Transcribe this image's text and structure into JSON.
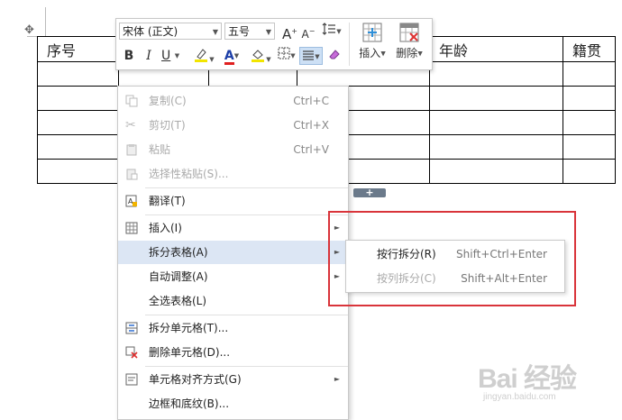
{
  "table": {
    "headers": [
      "序号",
      "",
      "",
      "",
      "年龄",
      "籍贯"
    ],
    "blank_rows": 5
  },
  "toolbar": {
    "font_name": "宋体 (正文)",
    "font_size": "五号",
    "grow_font_label": "A",
    "shrink_font_label": "A",
    "bold_label": "B",
    "italic_label": "I",
    "underline_label": "U",
    "font_color_label": "A",
    "insert_label": "插入",
    "delete_label": "删除",
    "highlight_color": "#f2e500",
    "font_color": "#e02020"
  },
  "context_menu": {
    "items": [
      {
        "label": "复制(C)",
        "shortcut": "Ctrl+C",
        "disabled": true
      },
      {
        "label": "剪切(T)",
        "shortcut": "Ctrl+X",
        "disabled": true
      },
      {
        "label": "粘贴",
        "shortcut": "Ctrl+V",
        "disabled": true
      },
      {
        "label": "选择性粘贴(S)...",
        "disabled": true
      },
      {
        "label": "翻译(T)"
      },
      {
        "label": "插入(I)",
        "has_submenu": true
      },
      {
        "label": "拆分表格(A)",
        "has_submenu": true,
        "highlighted": true
      },
      {
        "label": "自动调整(A)",
        "has_submenu": true
      },
      {
        "label": "全选表格(L)"
      },
      {
        "label": "拆分单元格(T)..."
      },
      {
        "label": "删除单元格(D)..."
      },
      {
        "label": "单元格对齐方式(G)",
        "has_submenu": true
      },
      {
        "label": "边框和底纹(B)..."
      }
    ]
  },
  "submenu": {
    "items": [
      {
        "label": "按行拆分(R)",
        "shortcut": "Shift+Ctrl+Enter"
      },
      {
        "label": "按列拆分(C)",
        "shortcut": "Shift+Alt+Enter",
        "disabled": true
      }
    ]
  },
  "watermark": {
    "brand": "Bai 经验",
    "url": "jingyan.baidu.com"
  },
  "colors": {
    "highlight_box": "#d9343a",
    "menu_highlight": "#dce6f4"
  }
}
